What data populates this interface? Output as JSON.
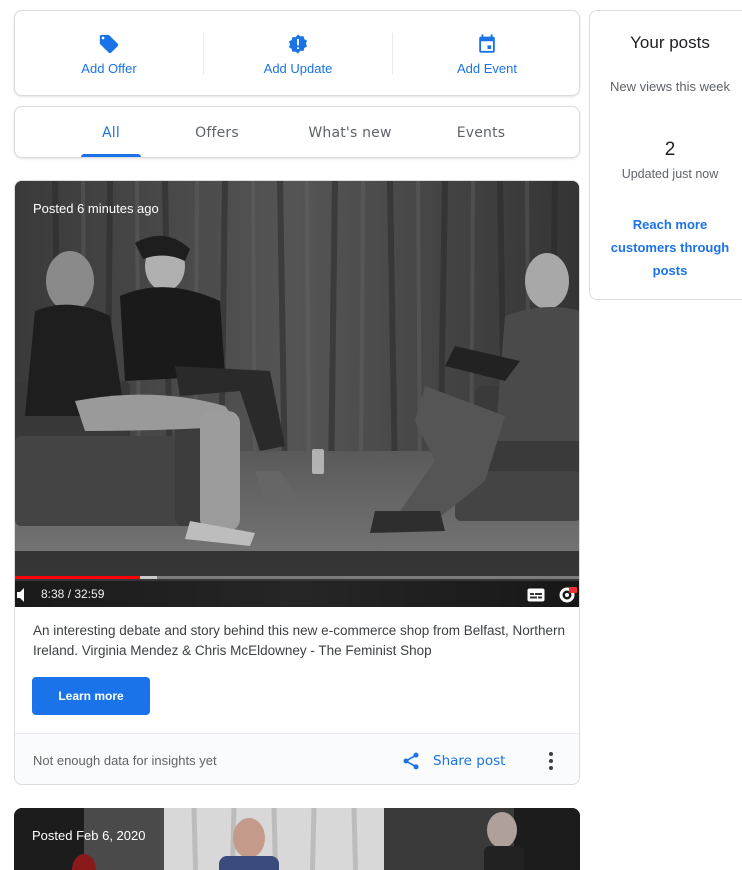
{
  "actions": {
    "offer_label": "Add Offer",
    "update_label": "Add Update",
    "event_label": "Add Event"
  },
  "tabs": [
    {
      "label": "All",
      "active": true
    },
    {
      "label": "Offers",
      "active": false
    },
    {
      "label": "What's new",
      "active": false
    },
    {
      "label": "Events",
      "active": false
    }
  ],
  "post": {
    "posted": "Posted 6 minutes ago",
    "video_time": "8:38 / 32:59",
    "progress": 0.22,
    "buffered": 0.25,
    "description": "An interesting debate and story behind this new e-commerce shop from Belfast, Northern Ireland. Virginia Mendez & Chris McEldowney - The Feminist Shop",
    "button_label": "Learn more",
    "insights": "Not enough data for insights yet",
    "share_label": "Share post"
  },
  "post2": {
    "posted": "Posted Feb 6, 2020"
  },
  "sidebar": {
    "title": "Your posts",
    "subtitle": "New views this week",
    "count": "2",
    "updated": "Updated just now",
    "link": "Reach more customers through posts"
  },
  "colors": {
    "accent": "#1a73e8",
    "progress": "#ff0000"
  }
}
